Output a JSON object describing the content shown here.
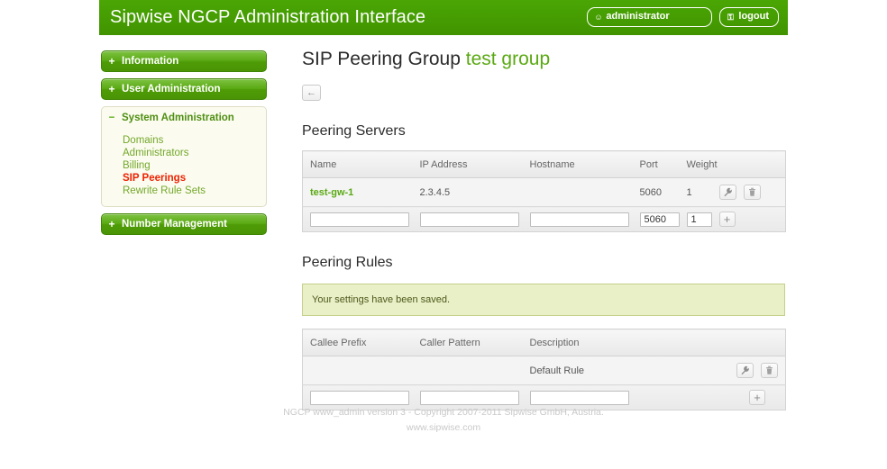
{
  "header": {
    "title": "Sipwise NGCP Administration Interface",
    "user_button": {
      "label": "administrator",
      "icon": "user-icon"
    },
    "logout_button": {
      "label": "logout",
      "icon": "lock-icon"
    },
    "brand_green": "#46a003"
  },
  "sidebar": {
    "items": [
      {
        "label": "Information",
        "sign": "+",
        "expanded": false
      },
      {
        "label": "User Administration",
        "sign": "+",
        "expanded": false
      },
      {
        "label": "System Administration",
        "sign": "−",
        "expanded": true,
        "children": [
          {
            "label": "Domains",
            "active": false
          },
          {
            "label": "Administrators",
            "active": false
          },
          {
            "label": "Billing",
            "active": false
          },
          {
            "label": "SIP Peerings",
            "active": true
          },
          {
            "label": "Rewrite Rule Sets",
            "active": false
          }
        ]
      },
      {
        "label": "Number Management",
        "sign": "+",
        "expanded": false
      }
    ],
    "active_color": "#ee2200",
    "link_color": "#74a829"
  },
  "main": {
    "page_title_prefix": "SIP Peering Group",
    "page_title_highlight": "test group",
    "back_button": {
      "label": "←",
      "name": "back-button"
    },
    "peering_servers": {
      "section_title": "Peering Servers",
      "columns": [
        "Name",
        "IP Address",
        "Hostname",
        "Port",
        "Weight",
        ""
      ],
      "rows": [
        {
          "name": "test-gw-1",
          "ip_address": "2.3.4.5",
          "hostname": "",
          "port": "5060",
          "weight": "1",
          "actions": [
            "edit-wrench-icon",
            "delete-trash-icon"
          ]
        }
      ],
      "new_row": {
        "name": "",
        "ip_address": "",
        "hostname": "",
        "port": "5060",
        "weight": "1",
        "add_label": "+"
      }
    },
    "peering_rules": {
      "section_title": "Peering Rules",
      "notice": "Your settings have been saved.",
      "columns": [
        "Callee Prefix",
        "Caller Pattern",
        "Description",
        ""
      ],
      "rows": [
        {
          "callee_prefix": "",
          "caller_pattern": "",
          "description": "Default Rule",
          "actions": [
            "edit-wrench-icon",
            "delete-trash-icon"
          ]
        }
      ],
      "new_row": {
        "callee_prefix": "",
        "caller_pattern": "",
        "description": "",
        "add_label": "+"
      }
    }
  },
  "footer": {
    "line1": "NGCP www_admin version 3 - Copyright 2007-2011 Sipwise GmbH, Austria.",
    "line2": "www.sipwise.com"
  }
}
